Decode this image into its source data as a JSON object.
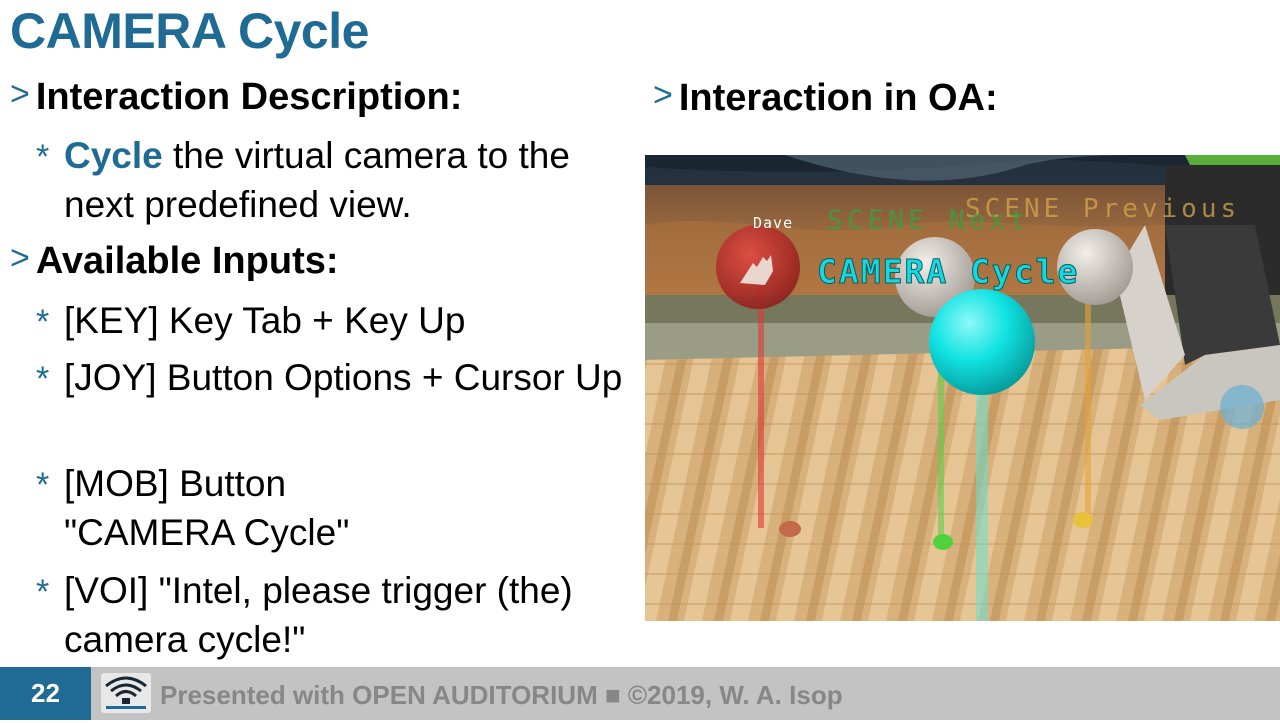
{
  "slide": {
    "title": "CAMERA Cycle",
    "left": {
      "heading1": "Interaction Description:",
      "desc_highlight": "Cycle",
      "desc_rest": " the virtual camera to the next predefined view.",
      "heading2": "Available Inputs:",
      "inputs": [
        "[KEY] Key Tab + Key Up",
        "[JOY] Button Options + Cursor Up",
        "[MOB] Button \"CAMERA Cycle\"",
        "[VOI] \"Intel, please trigger (the) camera cycle!\""
      ]
    },
    "right": {
      "heading": "Interaction in OA:",
      "scene_labels": {
        "user": "Dave",
        "next": "SCENE Next",
        "previous": "SCENE Previous",
        "camera": "CAMERA Cycle"
      }
    },
    "bullet_marker": ">",
    "item_marker": "*"
  },
  "footer": {
    "page_number": "22",
    "credit": "Presented with OPEN AUDITORIUM ■ ©2019, W. A. Isop"
  },
  "colors": {
    "accent": "#1f6b94",
    "footer_bg": "#c3c3c3",
    "credit_text": "#878787"
  }
}
